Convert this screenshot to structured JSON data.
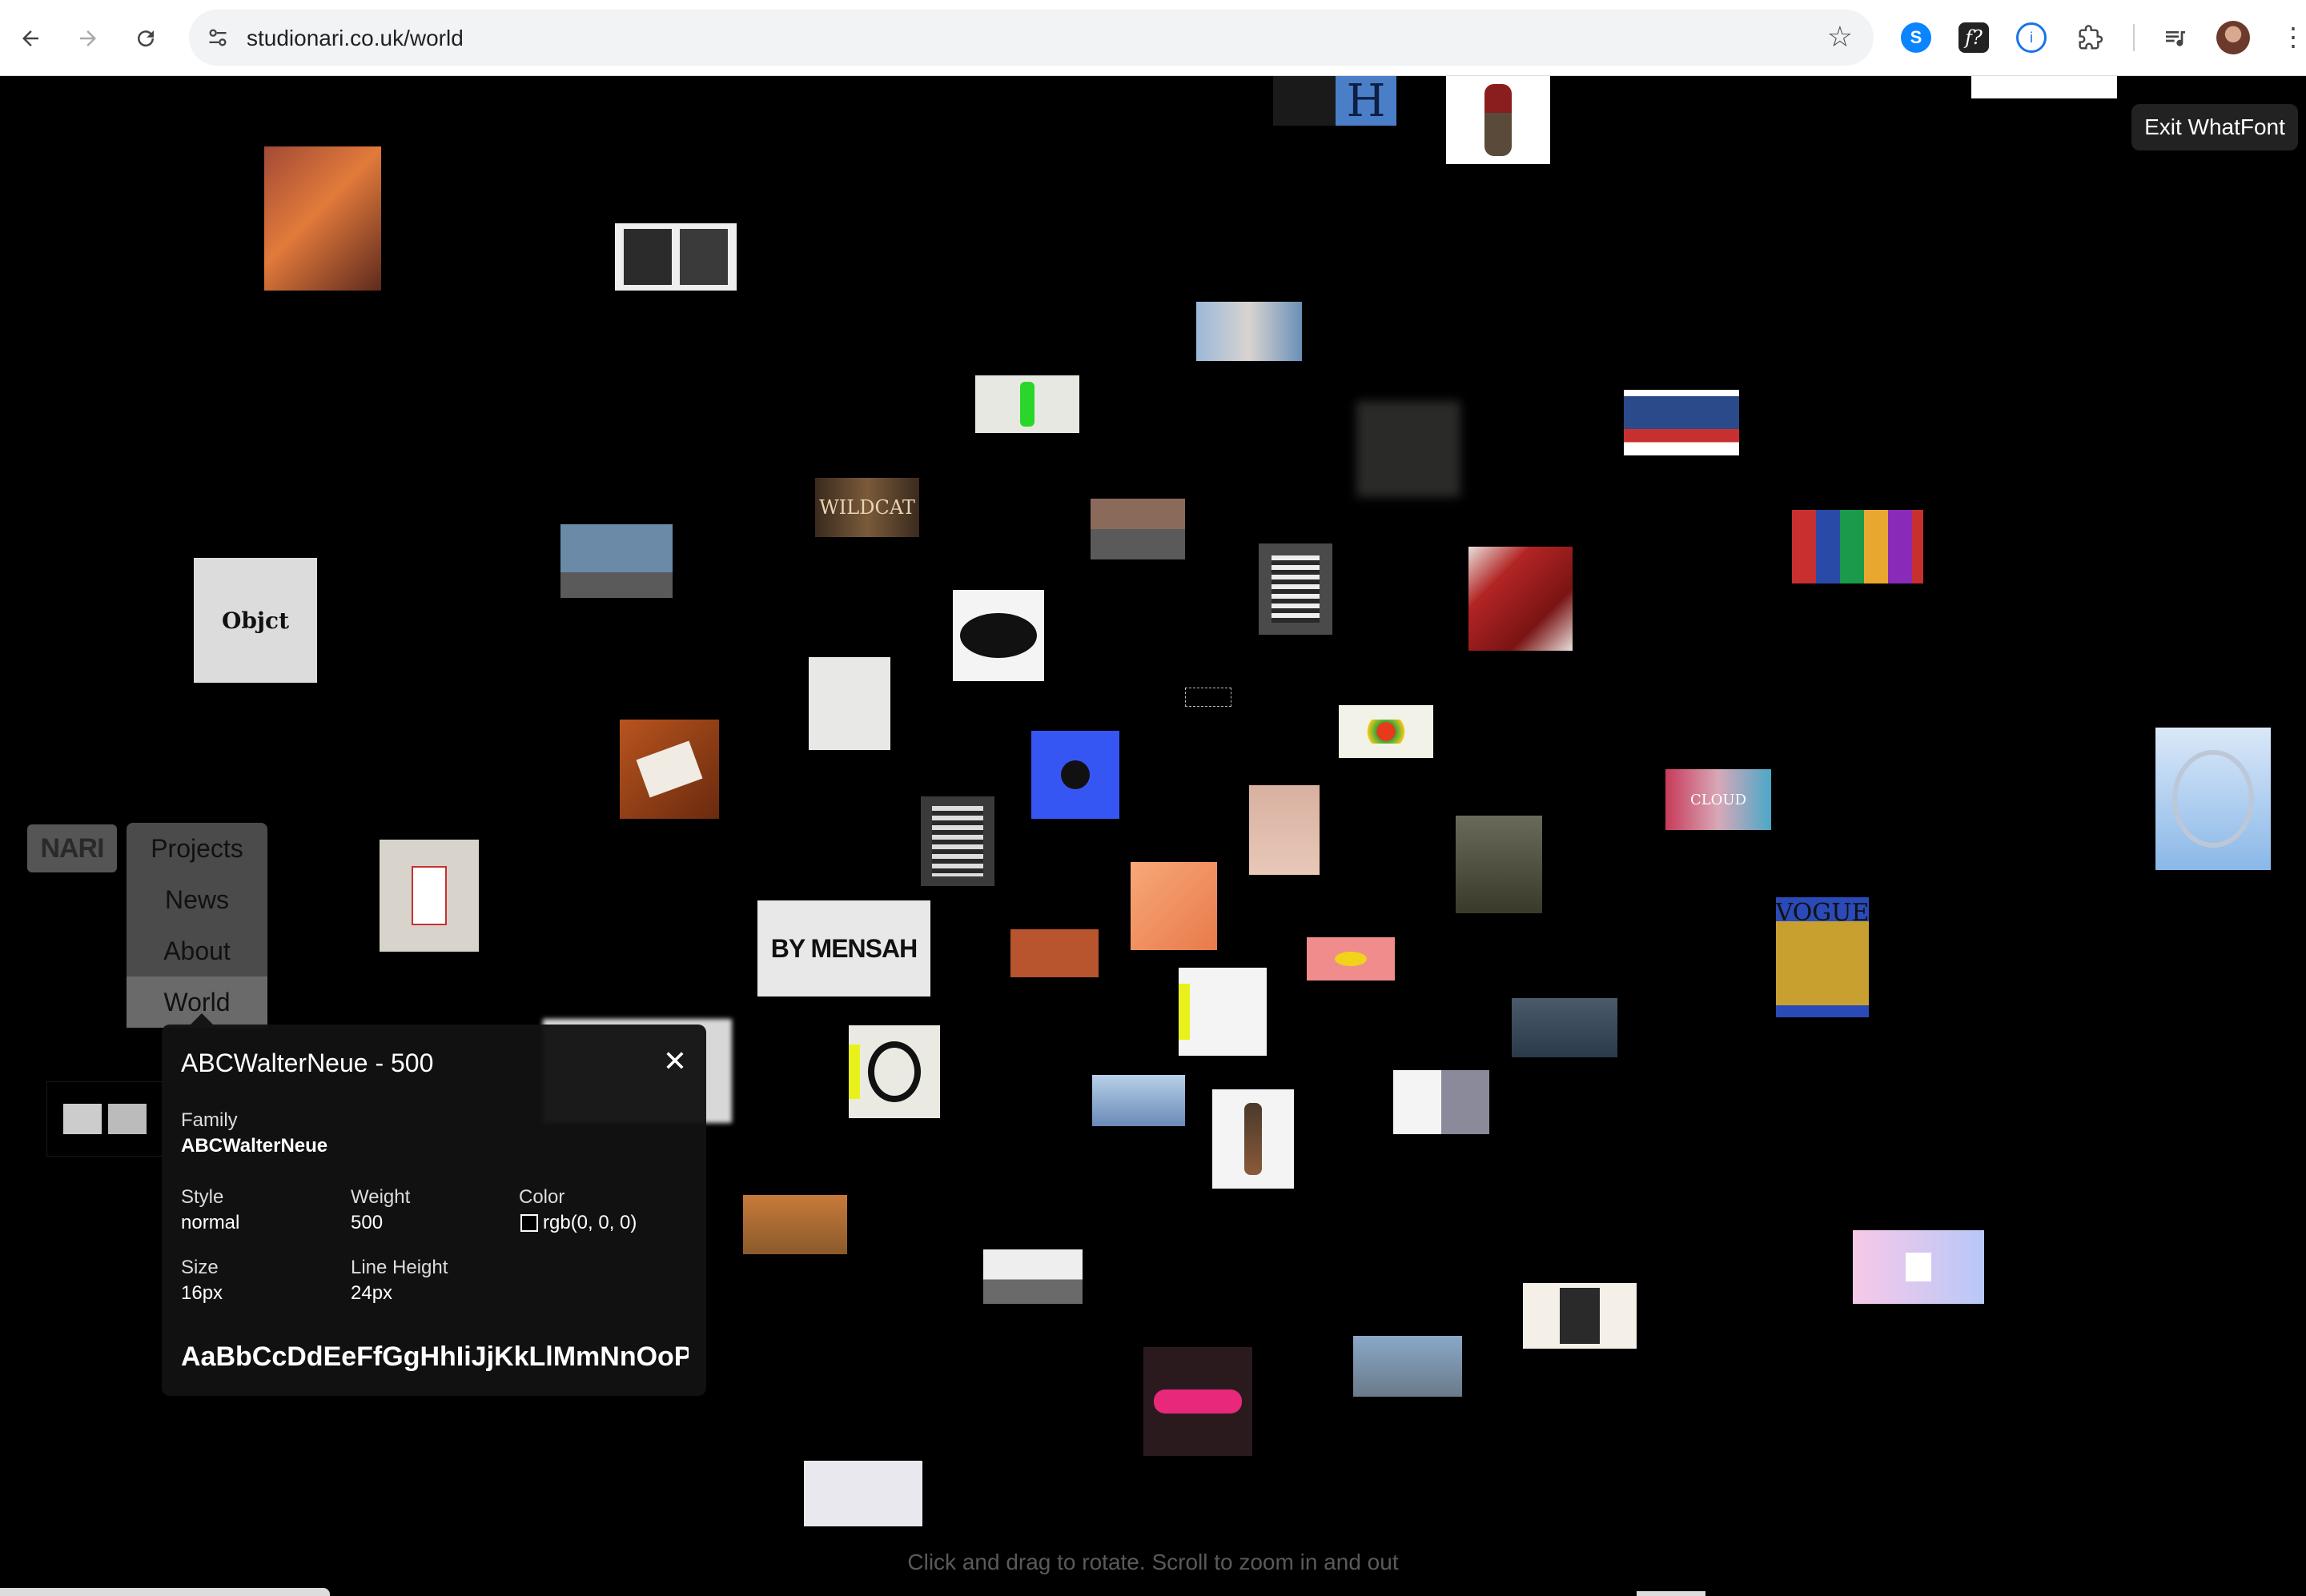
{
  "browser": {
    "url": "studionari.co.uk/world",
    "icons": [
      "back-arrow-icon",
      "forward-arrow-icon",
      "reload-icon",
      "site-info-icon",
      "bookmark-star-icon",
      "shazam-extension-icon",
      "whatfont-extension-icon",
      "password-manager-icon",
      "extensions-puzzle-icon",
      "media-controls-icon",
      "profile-avatar",
      "more-menu-icon"
    ]
  },
  "whatfont": {
    "exit_label": "Exit WhatFont",
    "title": "ABCWalterNeue - 500",
    "family_label": "Family",
    "family_value": "ABCWalterNeue",
    "style_label": "Style",
    "style_value": "normal",
    "weight_label": "Weight",
    "weight_value": "500",
    "color_label": "Color",
    "color_value": "rgb(0, 0, 0)",
    "size_label": "Size",
    "size_value": "16px",
    "lineheight_label": "Line Height",
    "lineheight_value": "24px",
    "sample": "AaBbCcDdEeFfGgHhIiJjKkLlMmNnOoPpQqRrSsTtUuVvWwXxYyZz"
  },
  "site": {
    "logo": "NARI",
    "menu": [
      "Projects",
      "News",
      "About",
      "World"
    ],
    "active_menu": "World",
    "hint": "Click and drag to rotate. Scroll to zoom in and out"
  },
  "tiles_text": {
    "object": "Objct",
    "wildcat": "WILDCAT",
    "mensah": "BY MENSAH",
    "cloud": "CLOUD",
    "vogue": "VOGUE",
    "h": "H"
  },
  "colors": {
    "background": "#000000",
    "chrome": "#ffffff",
    "panel": "#121212",
    "menu": "#4b4b4b"
  }
}
